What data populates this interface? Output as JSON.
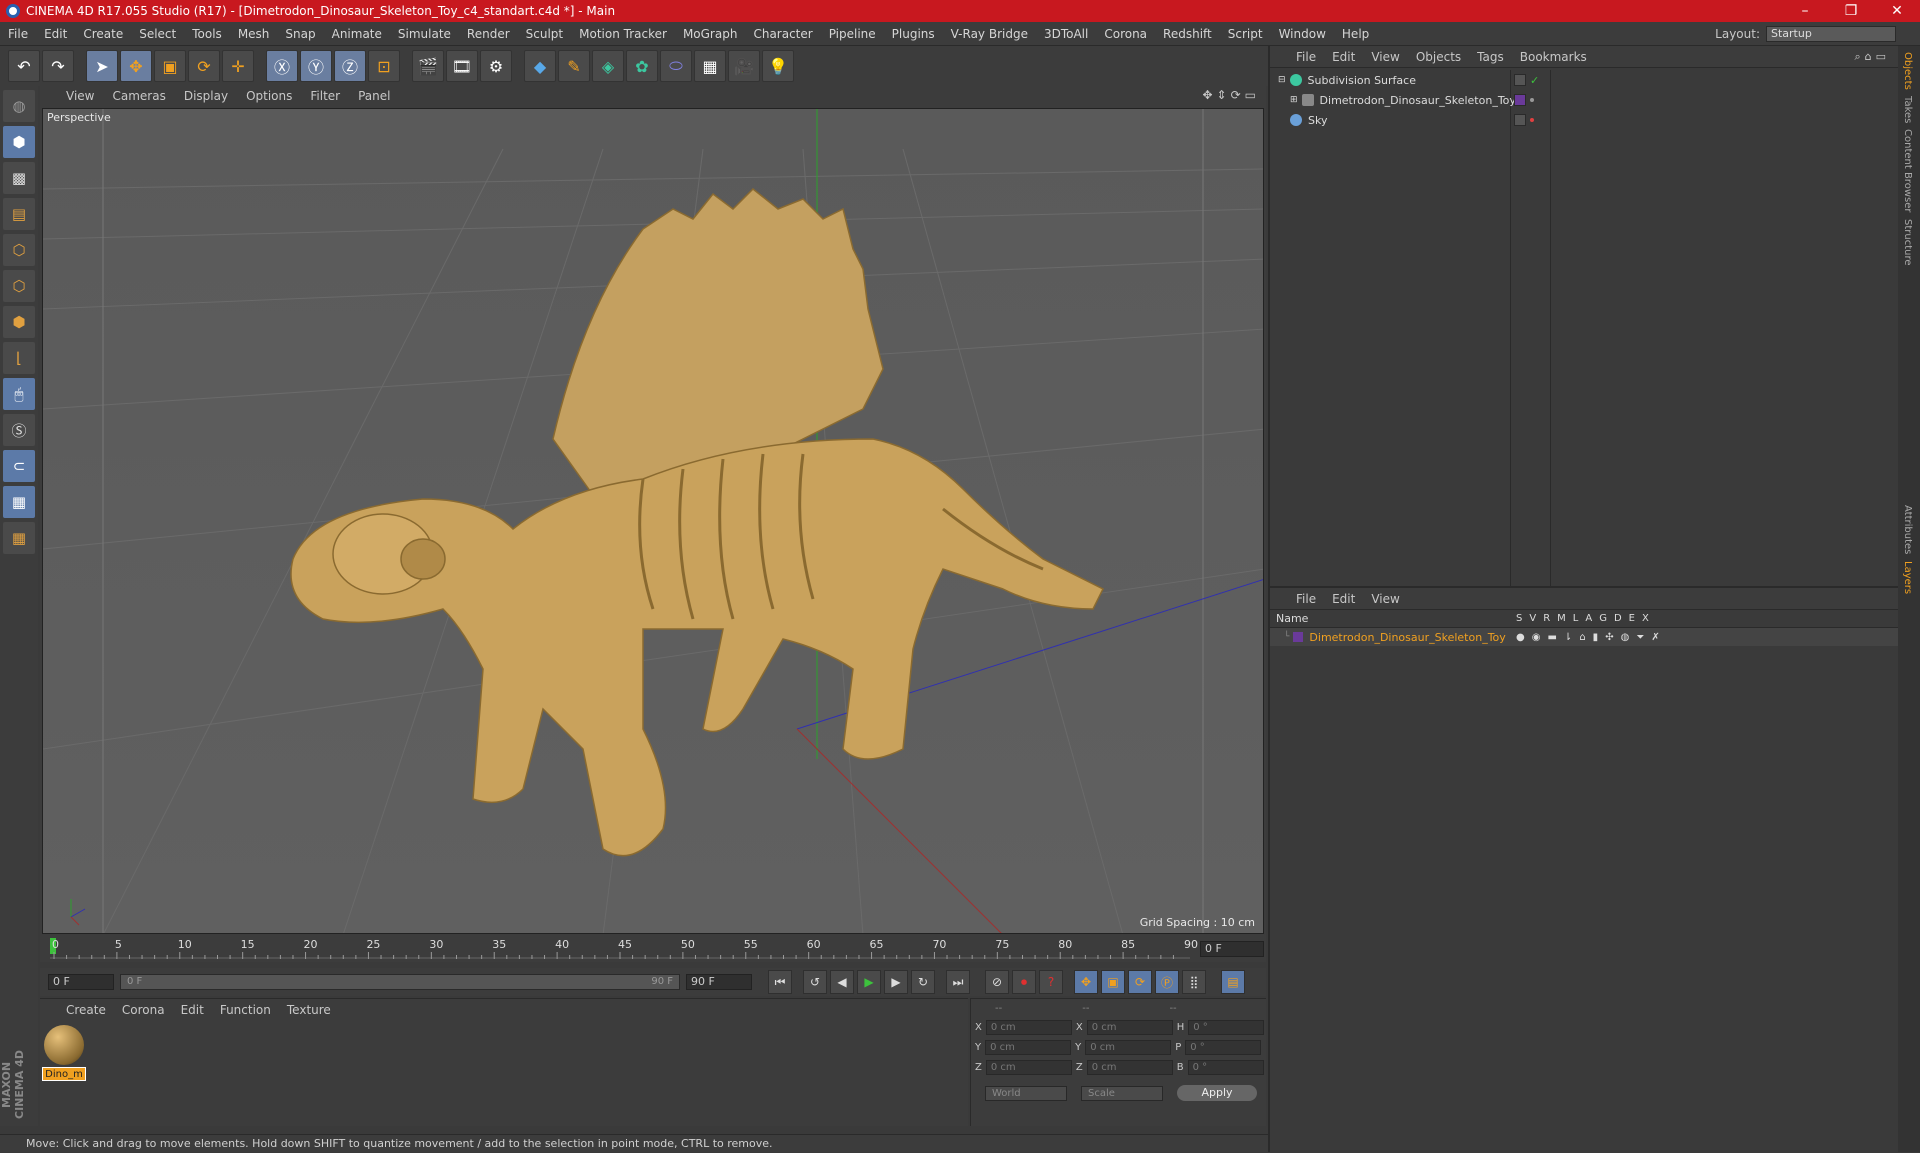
{
  "titlebar": {
    "title": "CINEMA 4D R17.055 Studio (R17) - [Dimetrodon_Dinosaur_Skeleton_Toy_c4_standart.c4d *] - Main",
    "minimize": "–",
    "maximize": "❐",
    "close": "✕"
  },
  "menubar": {
    "items": [
      "File",
      "Edit",
      "Create",
      "Select",
      "Tools",
      "Mesh",
      "Snap",
      "Animate",
      "Simulate",
      "Render",
      "Sculpt",
      "Motion Tracker",
      "MoGraph",
      "Character",
      "Pipeline",
      "Plugins",
      "V-Ray Bridge",
      "3DToAll",
      "Corona",
      "Redshift",
      "Script",
      "Window",
      "Help"
    ],
    "layout_label": "Layout:",
    "layout_value": "Startup"
  },
  "viewport": {
    "menu": [
      "View",
      "Cameras",
      "Display",
      "Options",
      "Filter",
      "Panel"
    ],
    "label": "Perspective",
    "grid_spacing": "Grid Spacing : 10 cm"
  },
  "timeline": {
    "ticks": [
      "0",
      "5",
      "10",
      "15",
      "20",
      "25",
      "30",
      "35",
      "40",
      "45",
      "50",
      "55",
      "60",
      "65",
      "70",
      "75",
      "80",
      "85",
      "90"
    ],
    "current_frame": "0 F",
    "start_frame": "0 F",
    "range_start": "0 F",
    "range_end": "90 F",
    "end_frame": "90 F"
  },
  "material_panel": {
    "menu": [
      "Create",
      "Corona",
      "Edit",
      "Function",
      "Texture"
    ],
    "material_name": "Dino_m"
  },
  "coord_panel": {
    "headers": [
      "--",
      "--",
      "--"
    ],
    "rows": [
      {
        "a": "X",
        "av": "0 cm",
        "b": "X",
        "bv": "0 cm",
        "c": "H",
        "cv": "0 °"
      },
      {
        "a": "Y",
        "av": "0 cm",
        "b": "Y",
        "bv": "0 cm",
        "c": "P",
        "cv": "0 °"
      },
      {
        "a": "Z",
        "av": "0 cm",
        "b": "Z",
        "bv": "0 cm",
        "c": "B",
        "cv": "0 °"
      }
    ],
    "space": "World",
    "mode": "Scale",
    "apply": "Apply"
  },
  "status": "Move: Click and drag to move elements. Hold down SHIFT to quantize movement / add to the selection in point mode, CTRL to remove.",
  "objects_panel": {
    "menu": [
      "File",
      "Edit",
      "View",
      "Objects",
      "Tags",
      "Bookmarks"
    ],
    "items": [
      {
        "name": "Subdivision Surface",
        "color": "#3cc8a0"
      },
      {
        "name": "Dimetrodon_Dinosaur_Skeleton_Toy",
        "color": "#a0a0a0"
      },
      {
        "name": "Sky",
        "color": "#6aa0d8"
      }
    ]
  },
  "layers_panel": {
    "menu": [
      "File",
      "Edit",
      "View"
    ],
    "name_header": "Name",
    "columns": [
      "S",
      "V",
      "R",
      "M",
      "L",
      "A",
      "G",
      "D",
      "E",
      "X"
    ],
    "layer_name": "Dimetrodon_Dinosaur_Skeleton_Toy"
  },
  "sidetabs": [
    "Objects",
    "Takes",
    "Content Browser",
    "Structure",
    "Attributes",
    "Layers"
  ],
  "brand": "MAXON CINEMA 4D"
}
